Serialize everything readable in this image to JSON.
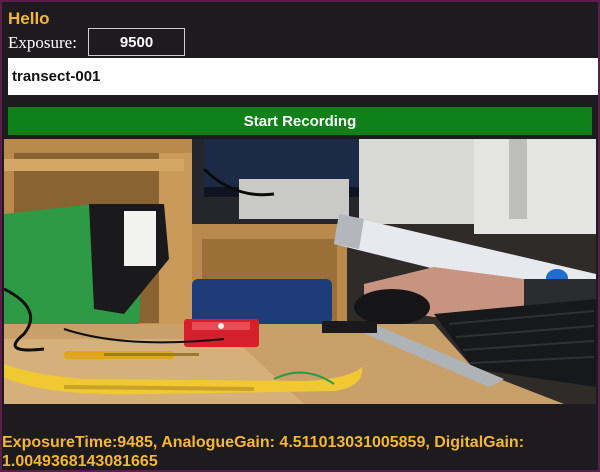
{
  "header": {
    "title": "Hello"
  },
  "exposure": {
    "label": "Exposure:",
    "value": "9500"
  },
  "session": {
    "name": "transect-001"
  },
  "controls": {
    "record_label": "Start Recording"
  },
  "camera": {
    "feed_icon": "camera-feed"
  },
  "status": {
    "text": "ExposureTime:9485, AnalogueGain: 4.511013031005859, DigitalGain: 1.0049368143081665"
  },
  "colors": {
    "accent": "#f5b731",
    "button": "#108018",
    "background": "#1d1b1d"
  }
}
